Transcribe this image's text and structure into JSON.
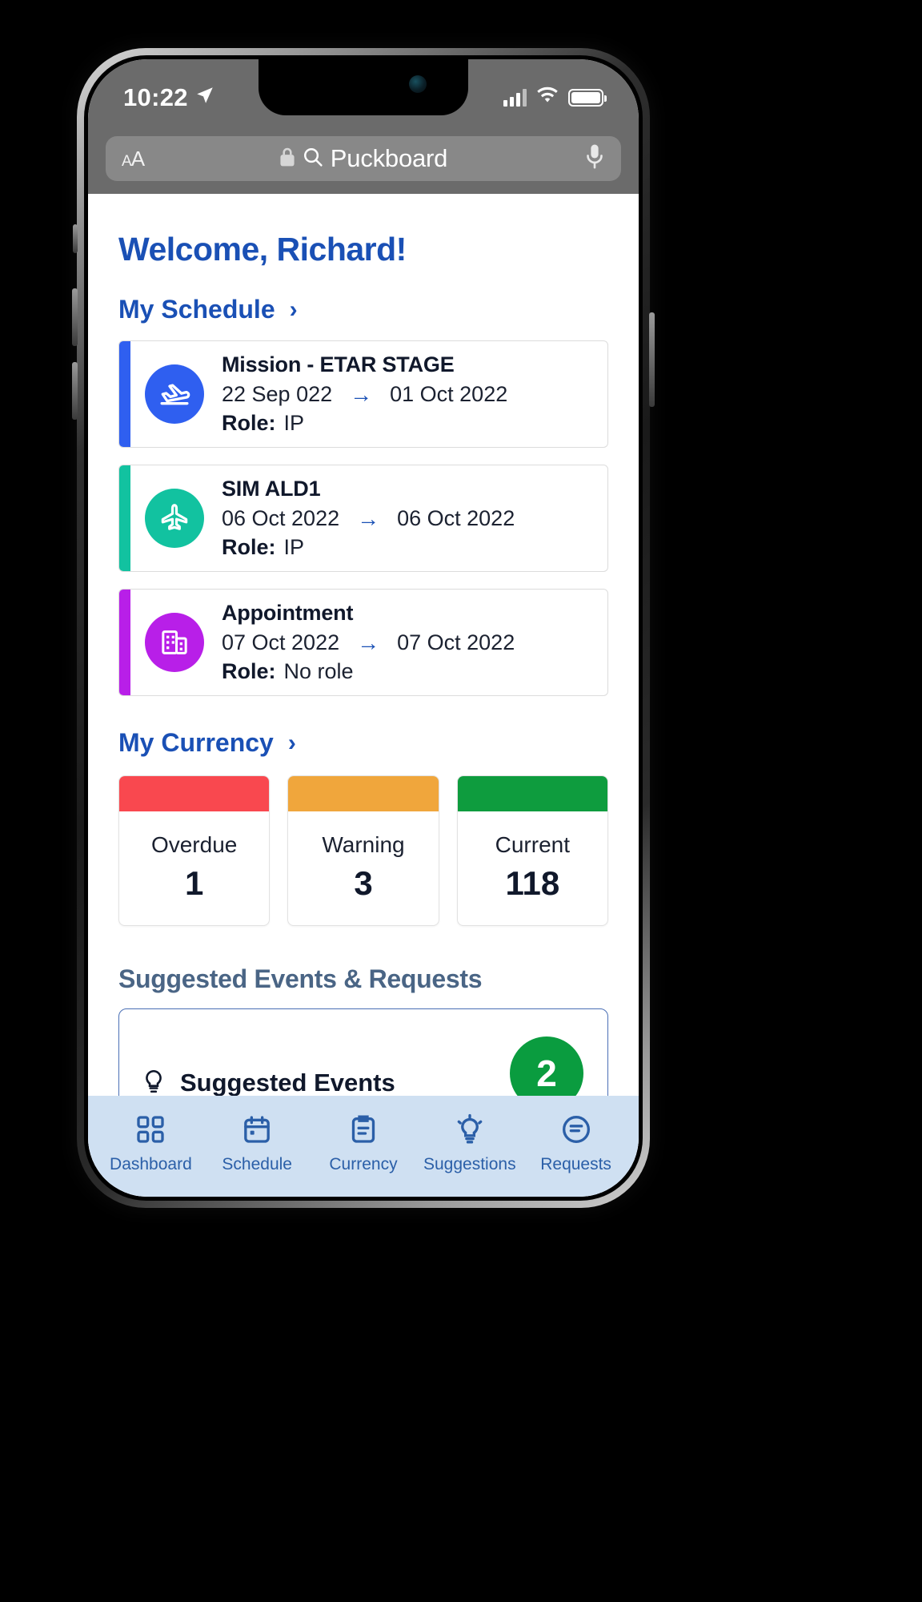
{
  "status_bar": {
    "time": "10:22",
    "location_icon": "location-arrow-icon",
    "signal_icon": "cellular-signal-icon",
    "wifi_icon": "wifi-icon",
    "battery_icon": "battery-full-icon"
  },
  "browser": {
    "text_size_label": "ᴀA",
    "lock_icon": "lock-icon",
    "search_icon": "search-icon",
    "url_text": "Puckboard",
    "mic_icon": "microphone-icon"
  },
  "app": {
    "welcome": "Welcome, Richard!",
    "schedule": {
      "heading": "My Schedule",
      "chevron": "›",
      "items": [
        {
          "title": "Mission - ETAR STAGE",
          "start_date": "22 Sep 022",
          "arrow": "→",
          "end_date": "01 Oct 2022",
          "role_label": "Role:",
          "role_value": "IP",
          "color": "#2F5FF0",
          "icon": "airplane-takeoff-icon"
        },
        {
          "title": "SIM ALD1",
          "start_date": "06 Oct 2022",
          "arrow": "→",
          "end_date": "06 Oct 2022",
          "role_label": "Role:",
          "role_value": "IP",
          "color": "#12C2A0",
          "icon": "airplane-top-icon"
        },
        {
          "title": "Appointment",
          "start_date": "07 Oct 2022",
          "arrow": "→",
          "end_date": "07 Oct 2022",
          "role_label": "Role:",
          "role_value": "No role",
          "color": "#B81FE8",
          "icon": "building-icon"
        }
      ]
    },
    "currency": {
      "heading": "My Currency",
      "chevron": "›",
      "items": [
        {
          "label": "Overdue",
          "value": "1",
          "color": "#F9484F"
        },
        {
          "label": "Warning",
          "value": "3",
          "color": "#F0A63C"
        },
        {
          "label": "Current",
          "value": "118",
          "color": "#0E9C3E"
        }
      ]
    },
    "suggestions": {
      "heading": "Suggested Events & Requests",
      "card_title": "Suggested Events",
      "card_icon": "lightbulb-icon",
      "fab_label": "2"
    }
  },
  "tabbar": {
    "tabs": [
      {
        "label": "Dashboard",
        "icon": "grid-icon",
        "active": true
      },
      {
        "label": "Schedule",
        "icon": "calendar-icon",
        "active": false
      },
      {
        "label": "Currency",
        "icon": "clipboard-icon",
        "active": false
      },
      {
        "label": "Suggestions",
        "icon": "lightbulb-icon",
        "active": false
      },
      {
        "label": "Requests",
        "icon": "message-icon",
        "active": false
      }
    ]
  },
  "colors": {
    "brand_blue": "#1a50b5",
    "tabbar_bg": "#cfe0f2",
    "heading_slate": "#4a6585"
  }
}
